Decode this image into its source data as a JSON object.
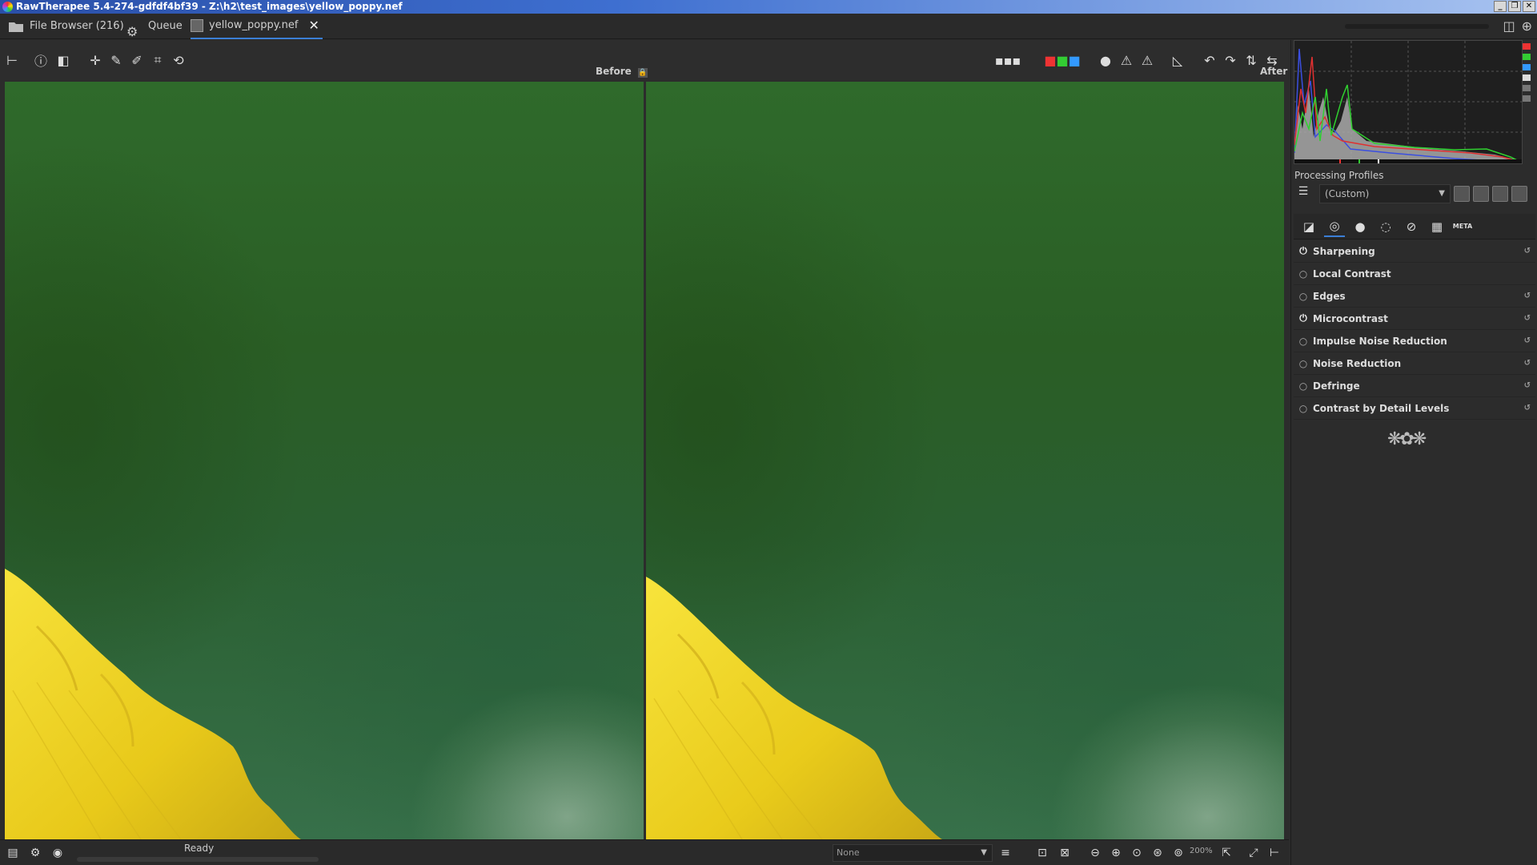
{
  "window": {
    "title": "RawTherapee 5.4-274-gdfdf4bf39 - Z:\\h2\\test_images\\yellow_poppy.nef",
    "buttons": [
      "_",
      "❐",
      "✕"
    ]
  },
  "tabs": [
    {
      "label": "File Browser (216)",
      "icon": "folder-icon"
    },
    {
      "label": "Queue",
      "icon": "gears-icon"
    },
    {
      "label": "yellow_poppy.nef",
      "icon": "image-icon",
      "active": true
    }
  ],
  "viewer": {
    "before_label": "Before",
    "after_label": "After"
  },
  "right_panel": {
    "profiles_label": "Processing Profiles",
    "profile_value": "(Custom)",
    "tool_tabs": [
      "exposure-icon",
      "detail-icon",
      "color-icon",
      "advanced-icon",
      "transform-icon",
      "raw-icon",
      "META"
    ],
    "tools": [
      {
        "label": "Sharpening",
        "enabled": true
      },
      {
        "label": "Local Contrast",
        "enabled": false
      },
      {
        "label": "Edges",
        "enabled": false
      },
      {
        "label": "Microcontrast",
        "enabled": true
      },
      {
        "label": "Impulse Noise Reduction",
        "enabled": false
      },
      {
        "label": "Noise Reduction",
        "enabled": false
      },
      {
        "label": "Defringe",
        "enabled": false
      },
      {
        "label": "Contrast by Detail Levels",
        "enabled": false
      }
    ]
  },
  "bottom": {
    "status": "Ready",
    "preview_select": "None",
    "zoom_level": "200%"
  },
  "colors": {
    "accent": "#3b7fd6",
    "leaf_green": "#2d6028",
    "petal_yellow": "#f2d61e"
  }
}
